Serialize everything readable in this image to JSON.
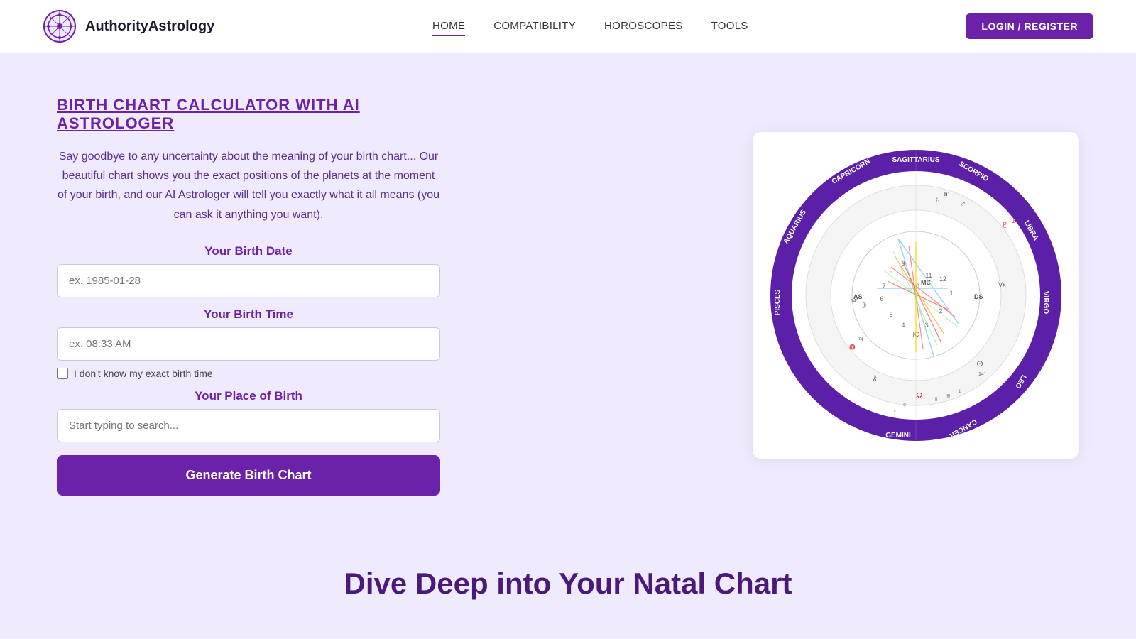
{
  "navbar": {
    "logo_text": "AuthorityAstrology",
    "nav_links": [
      {
        "id": "home",
        "label": "HOME",
        "active": true
      },
      {
        "id": "compatibility",
        "label": "COMPATIBILITY",
        "active": false
      },
      {
        "id": "horoscopes",
        "label": "HOROSCOPES",
        "active": false
      },
      {
        "id": "tools",
        "label": "TOOLS",
        "active": false
      }
    ],
    "login_label": "LOGIN / REGISTER"
  },
  "hero": {
    "title": "BIRTH CHART CALCULATOR WITH AI ASTROLOGER",
    "description": "Say goodbye to any uncertainty about the meaning of your birth chart... Our beautiful chart shows you the exact positions of the planets at the moment of your birth, and our AI Astrologer will tell you exactly what it all means (you can ask it anything you want).",
    "form": {
      "birth_date_label": "Your Birth Date",
      "birth_date_placeholder": "ex. 1985-01-28",
      "birth_time_label": "Your Birth Time",
      "birth_time_placeholder": "ex. 08:33 AM",
      "checkbox_label": "I don't know my exact birth time",
      "birth_place_label": "Your Place of Birth",
      "birth_place_placeholder": "Start typing to search...",
      "generate_button": "Generate Birth Chart"
    }
  },
  "bottom": {
    "title": "Dive Deep into Your Natal Chart"
  },
  "colors": {
    "purple_dark": "#6b21a8",
    "purple_light": "#f0eaff",
    "text_purple": "#5b2d8e"
  }
}
